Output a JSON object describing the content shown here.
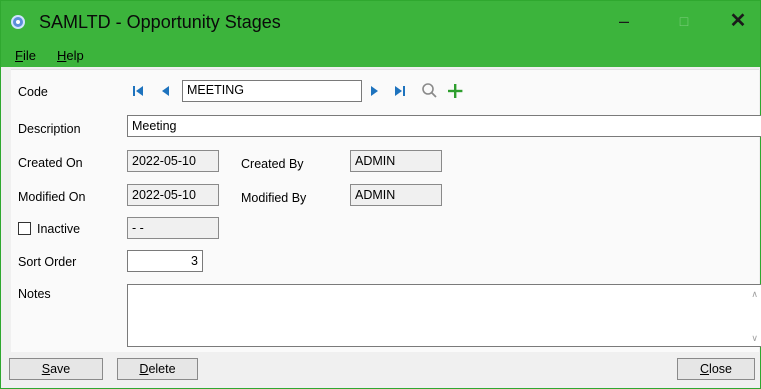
{
  "window": {
    "title": "SAMLTD - Opportunity Stages",
    "minimize_glyph": "–",
    "maximize_glyph": "□",
    "close_glyph": "✕"
  },
  "menu": {
    "file_mnemonic": "F",
    "file_rest": "ile",
    "help_mnemonic": "H",
    "help_rest": "elp"
  },
  "form": {
    "code_label": "Code",
    "code_value": "MEETING",
    "description_label": "Description",
    "description_value": "Meeting",
    "created_on_label": "Created On",
    "created_on_value": "2022-05-10",
    "created_by_label": "Created By",
    "created_by_value": "ADMIN",
    "modified_on_label": "Modified On",
    "modified_on_value": "2022-05-10",
    "modified_by_label": "Modified By",
    "modified_by_value": "ADMIN",
    "inactive_label": "Inactive",
    "inactive_checked": false,
    "inactive_date_value": "-  -",
    "sort_order_label": "Sort Order",
    "sort_order_value": "3",
    "notes_label": "Notes",
    "notes_value": ""
  },
  "icons": {
    "first": "first-record-icon",
    "prev": "previous-record-icon",
    "next": "next-record-icon",
    "last": "last-record-icon",
    "search": "search-icon",
    "add": "plus-icon"
  },
  "buttons": {
    "save_mnemonic": "S",
    "save_rest": "ave",
    "delete_mnemonic": "D",
    "delete_rest": "elete",
    "close_mnemonic": "C",
    "close_rest": "lose"
  },
  "colors": {
    "title_bar": "#3cb43c",
    "nav_arrow": "#1e73be",
    "add_icon": "#2e9e2e"
  }
}
